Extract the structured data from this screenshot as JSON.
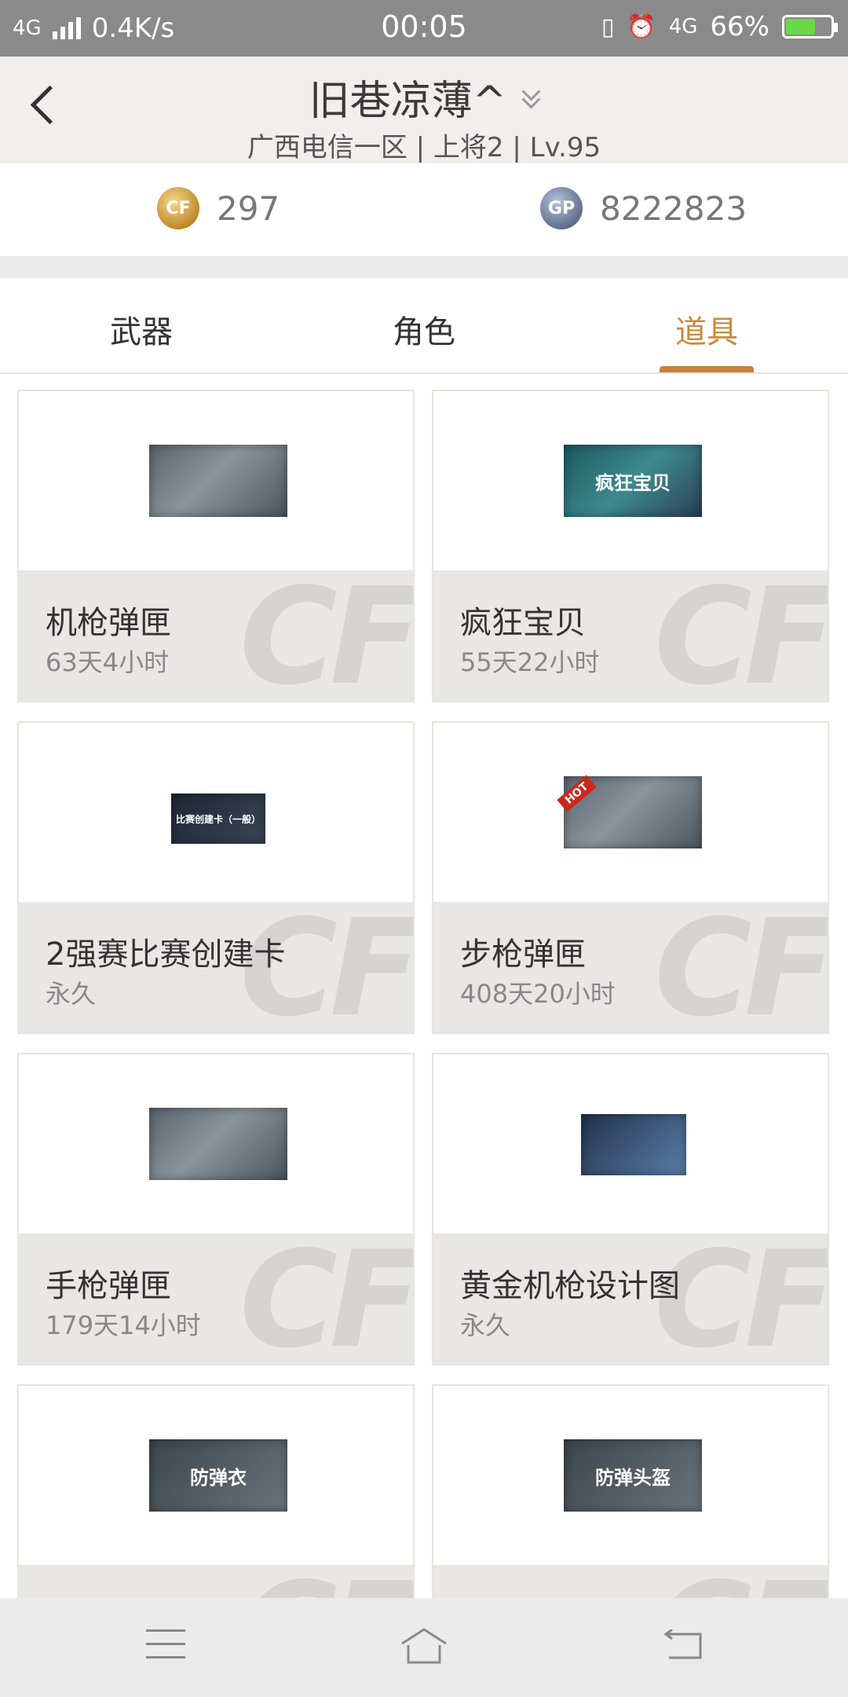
{
  "status_bar": {
    "network_left": "4G",
    "speed": "0.4K/s",
    "time": "00:05",
    "network_right": "4G",
    "battery": "66%",
    "battery_level": 0.66,
    "icons": [
      "signal-icon",
      "vibrate-icon",
      "alarm-icon",
      "battery-icon"
    ]
  },
  "header": {
    "title": "旧巷凉薄^",
    "subtitle": "广西电信一区 | 上将2 | Lv.95"
  },
  "currency": {
    "cf_label": "CF",
    "cf_amount": "297",
    "gp_label": "GP",
    "gp_amount": "8222823"
  },
  "tabs": [
    {
      "label": "武器",
      "active": false
    },
    {
      "label": "角色",
      "active": false
    },
    {
      "label": "道具",
      "active": true
    }
  ],
  "items": [
    {
      "name": "机枪弹匣",
      "time": "63天4小时",
      "thumb_text": ""
    },
    {
      "name": "疯狂宝贝",
      "time": "55天22小时",
      "thumb_text": "疯狂宝贝"
    },
    {
      "name": "2强赛比赛创建卡",
      "time": "永久",
      "thumb_text": "比赛创建卡（一般）"
    },
    {
      "name": "步枪弹匣",
      "time": "408天20小时",
      "thumb_text": "HOT"
    },
    {
      "name": "手枪弹匣",
      "time": "179天14小时",
      "thumb_text": ""
    },
    {
      "name": "黄金机枪设计图",
      "time": "永久",
      "thumb_text": ""
    },
    {
      "name": "",
      "time": "",
      "thumb_text": "防弹衣"
    },
    {
      "name": "",
      "time": "",
      "thumb_text": "防弹头盔"
    }
  ],
  "watermark": "CF",
  "colors": {
    "accent": "#c98a3c",
    "status_bar": "#8a8a8a",
    "header_bg": "#f1efec",
    "card_info_bg": "#e9e7e4"
  }
}
